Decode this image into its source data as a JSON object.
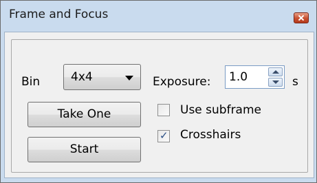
{
  "window": {
    "title": "Frame and Focus",
    "close_icon": "close-icon"
  },
  "bin": {
    "label": "Bin",
    "selected": "4x4"
  },
  "exposure": {
    "label": "Exposure:",
    "value": "1.0",
    "unit": "s"
  },
  "buttons": {
    "take_one": "Take One",
    "start": "Start"
  },
  "checkboxes": {
    "use_subframe": {
      "label": "Use subframe",
      "checked": false
    },
    "crosshairs": {
      "label": "Crosshairs",
      "checked": true,
      "mark": "✓"
    }
  },
  "colors": {
    "title_bar": "#c9dbee",
    "close_button": "#c75031",
    "client_bg": "#f0f0f0"
  }
}
